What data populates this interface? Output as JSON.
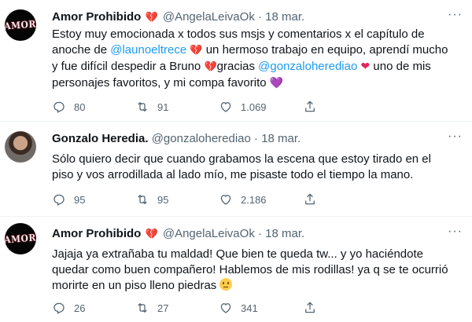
{
  "tweets": [
    {
      "name": "Amor Prohibido",
      "handle": "@AngelaLeivaOk",
      "separator": "·",
      "date": "18 mar.",
      "avatar_text": "AMOR",
      "body": {
        "line1": "Estoy muy emocionada x todos sus msjs y comentarios x el capítulo de",
        "line2_pre": "anoche de ",
        "mention1": "@launoeltrece",
        "line2_post": " un hermoso trabajo en equipo, aprendí mucho",
        "line3_pre": "y fue difícil despedir a Bruno ",
        "line3_mid": "gracias ",
        "mention2": "@gonzaloherediao",
        "line3_post": " uno de mis",
        "line4": "personajes favoritos, y mi compa favorito "
      },
      "actions": {
        "replies": "80",
        "retweets": "91",
        "likes": "1.069"
      }
    },
    {
      "name": "Gonzalo Heredia.",
      "handle": "@gonzaloherediao",
      "separator": "·",
      "date": "18 mar.",
      "body": {
        "line1": "Sólo quiero decir que cuando grabamos la escena que estoy tirado en el",
        "line2": "piso y vos arrodillada al lado mío, me pisaste todo el tiempo la mano."
      },
      "actions": {
        "replies": "95",
        "retweets": "95",
        "likes": "2.186"
      }
    },
    {
      "name": "Amor Prohibido",
      "handle": "@AngelaLeivaOk",
      "separator": "·",
      "date": "18 mar.",
      "avatar_text": "AMOR",
      "body": {
        "line1": "Jajaja ya extrañaba tu maldad! Que bien te queda tw... y yo haciéndote",
        "line2": "quedar como buen compañero! Hablemos de mis rodillas! ya q se te ocurrió",
        "line3": "morirte en un piso lleno piedras "
      },
      "actions": {
        "replies": "26",
        "retweets": "27",
        "likes": "341"
      }
    }
  ],
  "icons": {
    "verified_heart": "broken-heart-icon",
    "more": "more-icon",
    "reply": "reply-icon",
    "retweet": "retweet-icon",
    "like": "like-icon",
    "share": "share-icon"
  },
  "colors": {
    "mention": "#1d9bf0",
    "muted": "#536471",
    "text": "#0f1419",
    "heart": "#c51b3a"
  }
}
